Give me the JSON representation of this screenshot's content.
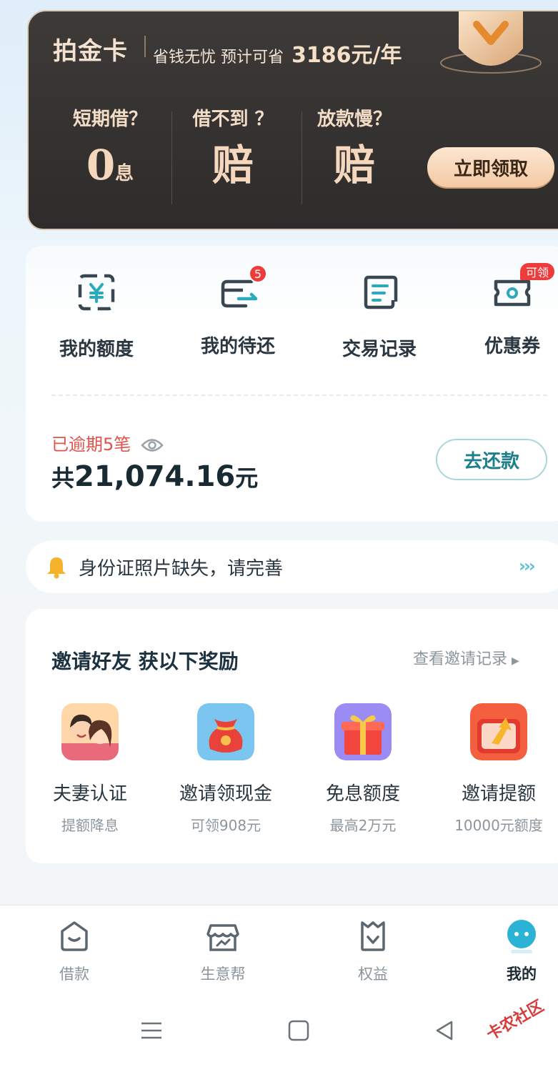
{
  "gold_card": {
    "title": "拍金卡",
    "subtitle_prefix": "省钱无忧 预计可省",
    "amount": "3186",
    "amount_unit": "元/年",
    "benefits": [
      {
        "question": "短期借？",
        "value": "0",
        "value_suffix": "息"
      },
      {
        "question": "借不到 ？",
        "value": "赔",
        "value_suffix": ""
      },
      {
        "question": "放款慢？",
        "value": "赔",
        "value_suffix": ""
      }
    ],
    "claim_label": "立即领取",
    "colors": {
      "card_bg": "#2e2c2b",
      "gold_text": "#f5d7bd",
      "button": "#f4caa5"
    }
  },
  "entries": [
    {
      "label": "我的额度",
      "icon": "yuan-quota-icon"
    },
    {
      "label": "我的待还",
      "icon": "card-repay-icon",
      "badge": "5"
    },
    {
      "label": "交易记录",
      "icon": "receipt-icon"
    },
    {
      "label": "优惠券",
      "icon": "coupon-icon",
      "tag": "可领"
    }
  ],
  "repayment": {
    "overdue_text": "已逾期5笔",
    "total_prefix": "共",
    "total_amount": "21,074.16",
    "total_suffix": "元",
    "button_label": "去还款",
    "colors": {
      "overdue": "#e0534b",
      "accent": "#1e7f8c"
    }
  },
  "notice": {
    "text": "身份证照片缺失，请完善",
    "arrows": "›››",
    "icon": "bell-icon"
  },
  "invite": {
    "title": "邀请好友 获以下奖励",
    "more_label": "查看邀请记录",
    "more_arrow": "▶",
    "rewards": [
      {
        "name": "夫妻认证",
        "desc": "提额降息",
        "icon": "couple-icon"
      },
      {
        "name": "邀请领现金",
        "desc": "可领908元",
        "icon": "red-pouch-icon"
      },
      {
        "name": "免息额度",
        "desc": "最高2万元",
        "icon": "gift-box-icon"
      },
      {
        "name": "邀请提额",
        "desc": "10000元额度",
        "icon": "up-arrow-box-icon"
      }
    ]
  },
  "bottom_nav": {
    "items": [
      {
        "label": "借款",
        "icon": "home-smile-icon",
        "active": false
      },
      {
        "label": "生意帮",
        "icon": "shop-icon",
        "active": false
      },
      {
        "label": "权益",
        "icon": "crown-shield-icon",
        "active": false
      },
      {
        "label": "我的",
        "icon": "profile-face-icon",
        "active": true
      }
    ]
  },
  "watermark": "卡农社区"
}
